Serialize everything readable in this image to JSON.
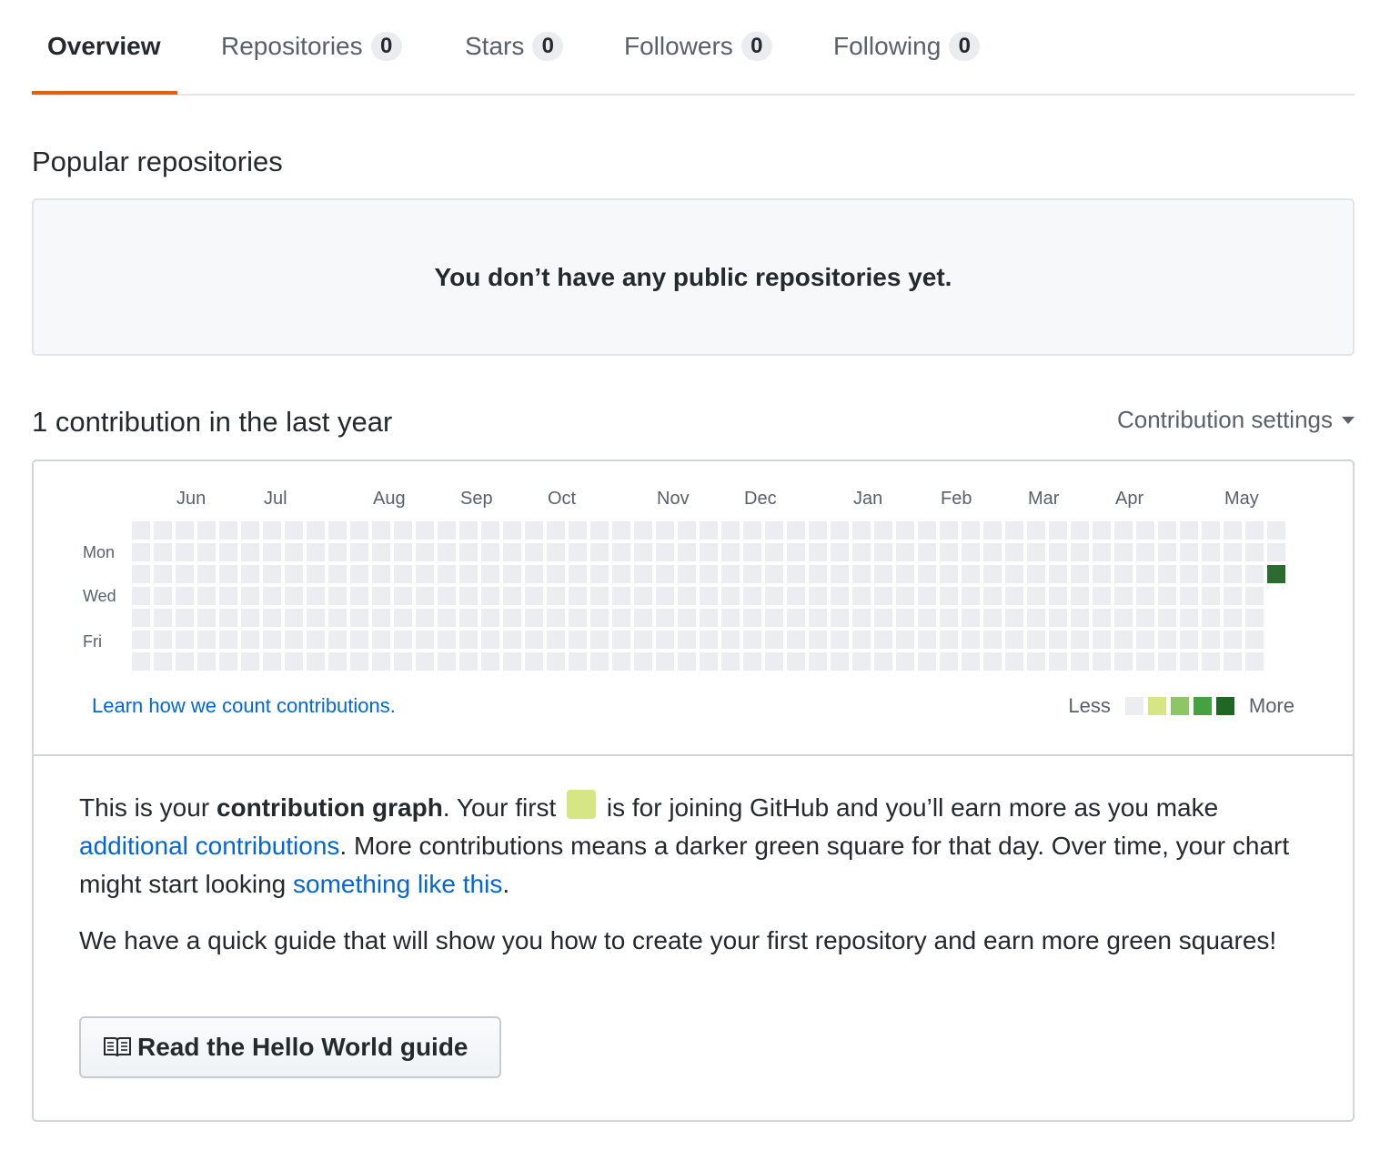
{
  "tabs": [
    {
      "label": "Overview",
      "count": null,
      "selected": true
    },
    {
      "label": "Repositories",
      "count": "0"
    },
    {
      "label": "Stars",
      "count": "0"
    },
    {
      "label": "Followers",
      "count": "0"
    },
    {
      "label": "Following",
      "count": "0"
    }
  ],
  "popular": {
    "title": "Popular repositories",
    "empty_message": "You don’t have any public repositories yet."
  },
  "contributions": {
    "title": "1 contribution in the last year",
    "settings_label": "Contribution settings",
    "months": [
      "Jun",
      "Jul",
      "Aug",
      "Sep",
      "Oct",
      "Nov",
      "Dec",
      "Jan",
      "Feb",
      "Mar",
      "Apr",
      "May"
    ],
    "days": [
      "Mon",
      "Wed",
      "Fri"
    ],
    "weeks": 53,
    "last_week_days": 3,
    "filled_cell": {
      "week": 52,
      "day": 2,
      "level": 4
    },
    "learn_link": "Learn how we count contributions.",
    "legend_less": "Less",
    "legend_more": "More",
    "colors": [
      "#ebedf0",
      "#c6e48b",
      "#7bc96f",
      "#239a3b",
      "#196127"
    ],
    "empty_color": "#ebedf0",
    "filled_color": "#2d6a30"
  },
  "intro": {
    "p1_a": "This is your ",
    "p1_b": "contribution graph",
    "p1_c": ". Your first ",
    "p1_d": " is for joining GitHub and you’ll earn more as you make ",
    "p1_link1": "additional contributions",
    "p1_e": ". More contributions means a darker green square for that day. Over time, your chart might start looking ",
    "p1_link2": "something like this",
    "p1_f": ".",
    "p2": "We have a quick guide that will show you how to create your first repository and earn more green squares!",
    "button_label": "Read the Hello World guide",
    "first_square_color": "#d6e685"
  }
}
